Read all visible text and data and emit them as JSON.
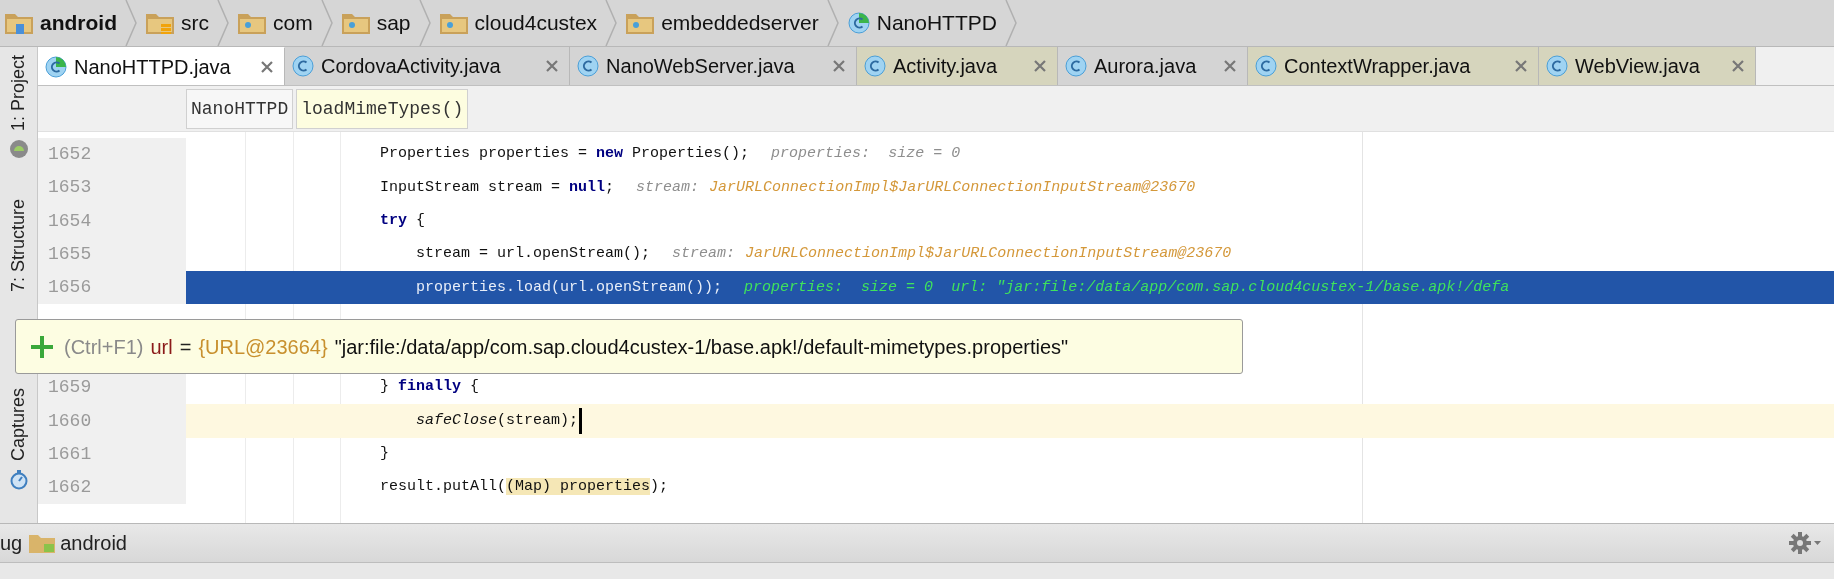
{
  "breadcrumbs": [
    {
      "label": "android",
      "kind": "module"
    },
    {
      "label": "src",
      "kind": "source"
    },
    {
      "label": "com",
      "kind": "package"
    },
    {
      "label": "sap",
      "kind": "package"
    },
    {
      "label": "cloud4custex",
      "kind": "package"
    },
    {
      "label": "embeddedserver",
      "kind": "package"
    },
    {
      "label": "NanoHTTPD",
      "kind": "class"
    }
  ],
  "tool_strip": [
    {
      "label": "1: Project",
      "kind": "android"
    },
    {
      "label": "7: Structure",
      "kind": "none"
    },
    {
      "label": "Captures",
      "kind": "stopwatch"
    }
  ],
  "tabs": [
    {
      "label": "NanoHTTPD.java",
      "selected": true,
      "kind": "source"
    },
    {
      "label": "CordovaActivity.java",
      "selected": false,
      "kind": "source"
    },
    {
      "label": "NanoWebServer.java",
      "selected": false,
      "kind": "source"
    },
    {
      "label": "Activity.java",
      "selected": false,
      "kind": "library"
    },
    {
      "label": "Aurora.java",
      "selected": false,
      "kind": "source"
    },
    {
      "label": "ContextWrapper.java",
      "selected": false,
      "kind": "library"
    },
    {
      "label": "WebView.java",
      "selected": false,
      "kind": "library"
    }
  ],
  "navigation": [
    {
      "label": "NanoHTTPD",
      "selected": false
    },
    {
      "label": "loadMimeTypes()",
      "selected": true
    }
  ],
  "lines": [
    {
      "number": "1652",
      "kind": "normal",
      "tokens": [
        {
          "text": "                Properties properties = ",
          "kind": "plain"
        },
        {
          "text": "new",
          "kind": "keyword"
        },
        {
          "text": " Properties();",
          "kind": "plain"
        }
      ],
      "hint": {
        "text": "properties:  size = 0"
      }
    },
    {
      "number": "1653",
      "kind": "normal",
      "tokens": [
        {
          "text": "                InputStream stream = ",
          "kind": "plain"
        },
        {
          "text": "null",
          "kind": "keyword"
        },
        {
          "text": ";",
          "kind": "plain"
        }
      ],
      "hint": {
        "text": "stream:",
        "value": "JarURLConnectionImpl$JarURLConnectionInputStream@23670"
      }
    },
    {
      "number": "1654",
      "kind": "normal",
      "tokens": [
        {
          "text": "                try",
          "kind": "keyword"
        },
        {
          "text": " {",
          "kind": "plain"
        }
      ]
    },
    {
      "number": "1655",
      "kind": "normal",
      "tokens": [
        {
          "text": "                    stream = url.openStream();",
          "kind": "plain"
        }
      ],
      "hint": {
        "text": "stream:",
        "value": "JarURLConnectionImpl$JarURLConnectionInputStream@23670"
      }
    },
    {
      "number": "1656",
      "kind": "execution",
      "tokens": [
        {
          "text": "                    properties.load(url.openStream());",
          "kind": "plain"
        }
      ],
      "hint": {
        "text": "properties:  size = 0  url: \"jar:file:/data/app/com.sap.cloud4custex-1/base.apk!/defa"
      }
    },
    {
      "kind": "hidden"
    },
    {
      "kind": "hidden"
    },
    {
      "number": "1659",
      "kind": "normal",
      "tokens": [
        {
          "text": "                } ",
          "kind": "plain"
        },
        {
          "text": "finally",
          "kind": "keyword"
        },
        {
          "text": " {",
          "kind": "plain"
        }
      ]
    },
    {
      "number": "1660",
      "kind": "caret",
      "tokens": [
        {
          "text": "                    safeClose",
          "kind": "static"
        },
        {
          "text": "(stream);",
          "kind": "plain"
        }
      ]
    },
    {
      "number": "1661",
      "kind": "normal",
      "tokens": [
        {
          "text": "                }",
          "kind": "plain"
        }
      ]
    },
    {
      "number": "1662",
      "kind": "normal",
      "tokens": [
        {
          "text": "                result.putAll(",
          "kind": "plain"
        },
        {
          "text": "(Map) properties",
          "kind": "highlight"
        },
        {
          "text": ");",
          "kind": "plain"
        }
      ]
    }
  ],
  "tooltip": {
    "shortcut": "(Ctrl+F1)",
    "name": "url",
    "equals": "=",
    "reference": "{URL@23664}",
    "value": "\"jar:file:/data/app/com.sap.cloud4custex-1/base.apk!/default-mimetypes.properties\""
  },
  "bottom_bar": {
    "tab_fragment": "ug",
    "project": "android"
  }
}
